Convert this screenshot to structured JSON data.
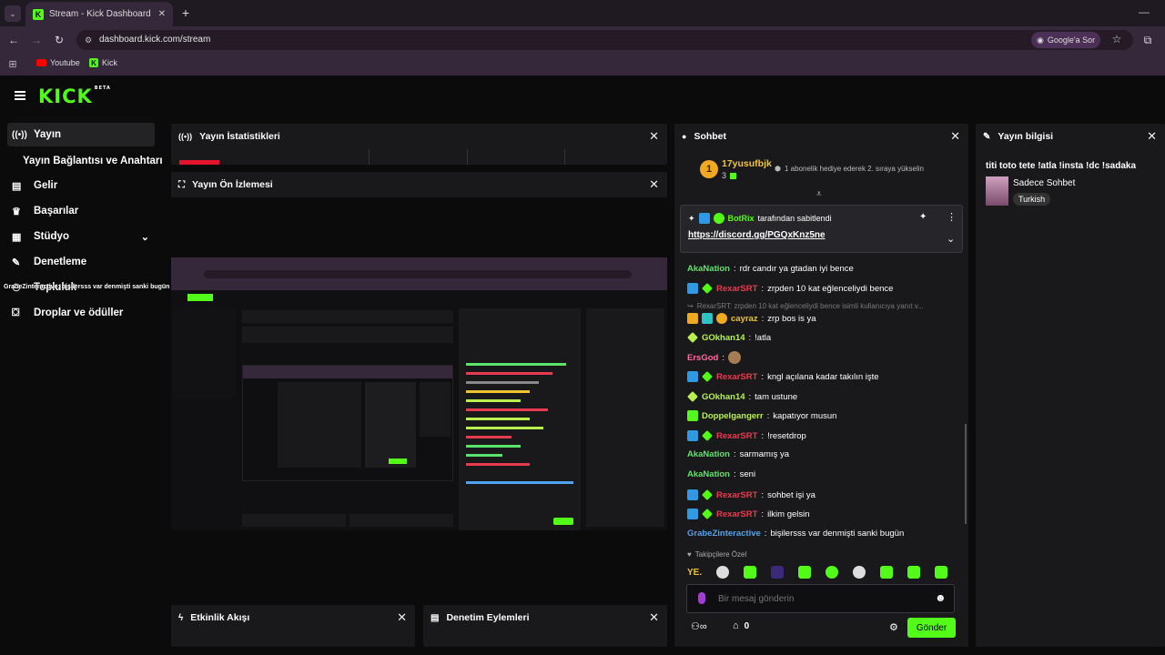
{
  "browser": {
    "tab_title": "Stream - Kick Dashboard",
    "url": "dashboard.kick.com/stream",
    "ask_google": "Google'a Sor",
    "bookmarks": [
      "Youtube",
      "Kick"
    ]
  },
  "app": {
    "logo": "KICK",
    "beta": "BETA"
  },
  "sidebar": {
    "items": [
      {
        "label": "Yayın",
        "icon": "broadcast-icon"
      },
      {
        "label": "Yayın Bağlantısı ve Anahtarı"
      },
      {
        "label": "Gelir",
        "icon": "chart-icon"
      },
      {
        "label": "Başarılar",
        "icon": "trophy-icon"
      },
      {
        "label": "Stüdyo",
        "icon": "studio-icon"
      },
      {
        "label": "Denetleme",
        "icon": "wrench-icon"
      },
      {
        "label": "Topluluk",
        "icon": "community-icon"
      },
      {
        "label": "Droplar ve ödüller",
        "icon": "gift-icon"
      }
    ],
    "overlay_text": "GrabeZinteractive: bişilersss var denmişti sanki bugün"
  },
  "panels": {
    "stats": {
      "title": "Yayın İstatistikleri"
    },
    "preview": {
      "title": "Yayın Ön İzlemesi"
    },
    "activity": {
      "title": "Etkinlik Akışı"
    },
    "mod_actions": {
      "title": "Denetim Eylemleri"
    },
    "chat": {
      "title": "Sohbet"
    },
    "info": {
      "title": "Yayın bilgisi"
    }
  },
  "chat": {
    "top_gifter": {
      "name": "17yusufbjk",
      "count": "3",
      "rank": "1",
      "gift_text": "1 abonelik hediye ederek 2. sıraya yükselin"
    },
    "pinned": {
      "by": "BotRix",
      "by_suffix": "tarafından sabitlendi",
      "link": "https://discord.gg/PGQxKnz5ne"
    },
    "messages": [
      {
        "user": "AkaNation",
        "text": "rdr candır ya gtadan iyi bence",
        "color": "#5be46a"
      },
      {
        "user": "RexarSRT",
        "text": "zrpden 10 kat eğlenceliydi bence",
        "color": "#e83a4f"
      },
      {
        "reply": "RexarSRT: zrpden 10 kat eğlenceliydi bence isimli kullanıcıya yanıt v..."
      },
      {
        "user": "cayraz",
        "text": "zrp bos is ya",
        "color": "#f0c330"
      },
      {
        "user": "GOkhan14",
        "text": "!atla",
        "color": "#b7f04f"
      },
      {
        "user": "ErsGod",
        "text": "",
        "color": "#ff6b9d"
      },
      {
        "user": "RexarSRT",
        "text": "kngl açılana kadar takılın işte",
        "color": "#e83a4f"
      },
      {
        "user": "GOkhan14",
        "text": "tam ustune",
        "color": "#b7f04f"
      },
      {
        "user": "Doppelgangerr",
        "text": "kapatıyor musun",
        "color": "#b7f04f"
      },
      {
        "user": "RexarSRT",
        "text": "!resetdrop",
        "color": "#e83a4f"
      },
      {
        "user": "AkaNation",
        "text": "sarmamış ya",
        "color": "#5be46a"
      },
      {
        "user": "AkaNation",
        "text": "seni",
        "color": "#5be46a"
      },
      {
        "user": "RexarSRT",
        "text": "sohbet işi ya",
        "color": "#e83a4f"
      },
      {
        "user": "RexarSRT",
        "text": "ilkim gelsin",
        "color": "#e83a4f"
      },
      {
        "user": "GrabeZinteractive",
        "text": "bişilersss var denmişti sanki bugün",
        "color": "#4fa3f0"
      }
    ],
    "followers_label": "Takipçilere Özel",
    "emote_first": "YE.",
    "input_placeholder": "Bir mesaj gönderin",
    "points": "0",
    "send": "Gönder"
  },
  "info": {
    "stream_title": "titi toto tete !atla !insta !dc !sadaka",
    "category": "Sadece Sohbet",
    "tag": "Turkish"
  },
  "colors": {
    "brand": "#53fc18",
    "panel": "#19191b",
    "bg": "#0b0b0c"
  }
}
